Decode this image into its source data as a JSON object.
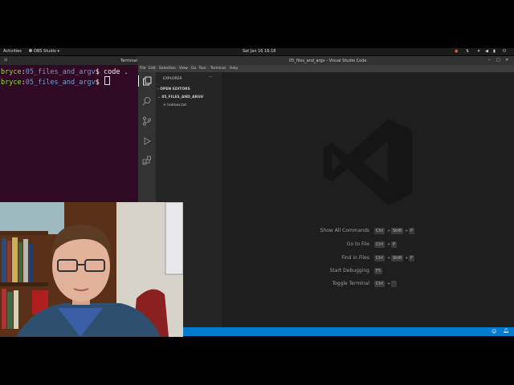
{
  "topbar": {
    "activities": "Activities",
    "app": "OBS Studio ▾",
    "datetime": "Sat Jan 16  16:18"
  },
  "terminal": {
    "title": "Terminal",
    "lines": [
      {
        "user": "bryce",
        "path": "05_files_and_argv",
        "cmd": "code ."
      },
      {
        "user": "bryce",
        "path": "05_files_and_argv",
        "cmd": ""
      }
    ]
  },
  "vscode": {
    "title": "05_files_and_argv - Visual Studio Code",
    "menu": [
      "File",
      "Edit",
      "Selection",
      "View",
      "Go",
      "Run",
      "Terminal",
      "Help"
    ],
    "sidebar": {
      "header": "EXPLORER",
      "more": "···",
      "open_editors": "OPEN EDITORS",
      "folder": "05_FILES_AND_ARGV",
      "file": "holmes.txt"
    },
    "shortcuts": [
      {
        "label": "Show All Commands",
        "keys": [
          "Ctrl",
          "+",
          "Shift",
          "+",
          "P"
        ]
      },
      {
        "label": "Go to File",
        "keys": [
          "Ctrl",
          "+",
          "P"
        ]
      },
      {
        "label": "Find in Files",
        "keys": [
          "Ctrl",
          "+",
          "Shift",
          "+",
          "F"
        ]
      },
      {
        "label": "Start Debugging",
        "keys": [
          "F5"
        ]
      },
      {
        "label": "Toggle Terminal",
        "keys": [
          "Ctrl",
          "+",
          "`"
        ]
      }
    ]
  },
  "colors": {
    "terminal_bg": "#300a24",
    "vscode_accent": "#007acc",
    "editor_bg": "#1e1e1e"
  }
}
